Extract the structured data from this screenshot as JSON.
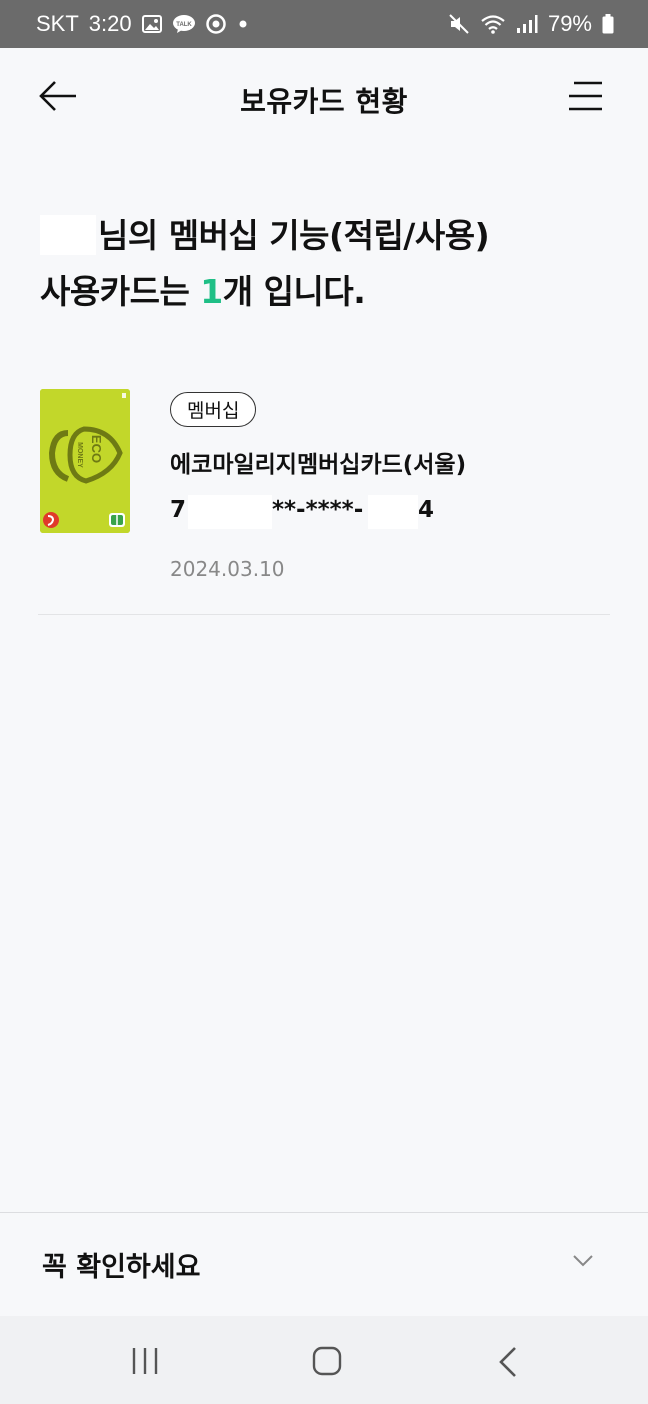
{
  "status": {
    "carrier": "SKT",
    "time": "3:20",
    "battery": "79%",
    "left_icons": [
      "gallery-icon",
      "kakaotalk-icon",
      "chrome-icon",
      "dot-icon"
    ],
    "right_icons": [
      "mute-icon",
      "wifi-icon",
      "signal-icon",
      "battery-icon"
    ]
  },
  "appbar": {
    "title": "보유카드 현황",
    "back_icon": "arrow-left-icon",
    "menu_icon": "hamburger-icon"
  },
  "headline": {
    "line1": "님의 멤버십 기능(적립/사용)",
    "line2_prefix": "사용카드는 ",
    "count": "1",
    "line2_suffix": "개 입니다.",
    "count_color": "#1fbf86"
  },
  "card": {
    "badge": "멤버십",
    "name": "에코마일리지멤버십카드(서울)",
    "number_part1": "7",
    "number_part2": "**-****-",
    "number_part3": "4",
    "date": "2024.03.10",
    "image": {
      "logo_text_top": "ECO",
      "logo_text_bottom": "MONEY",
      "background": "#c2d72a",
      "logo_color": "#6e7a14"
    }
  },
  "notice": {
    "label": "꼭 확인하세요",
    "chevron_icon": "chevron-down-icon"
  },
  "navbar": {
    "recent_icon": "recent-apps-icon",
    "home_icon": "home-icon",
    "back_icon": "nav-back-icon"
  }
}
